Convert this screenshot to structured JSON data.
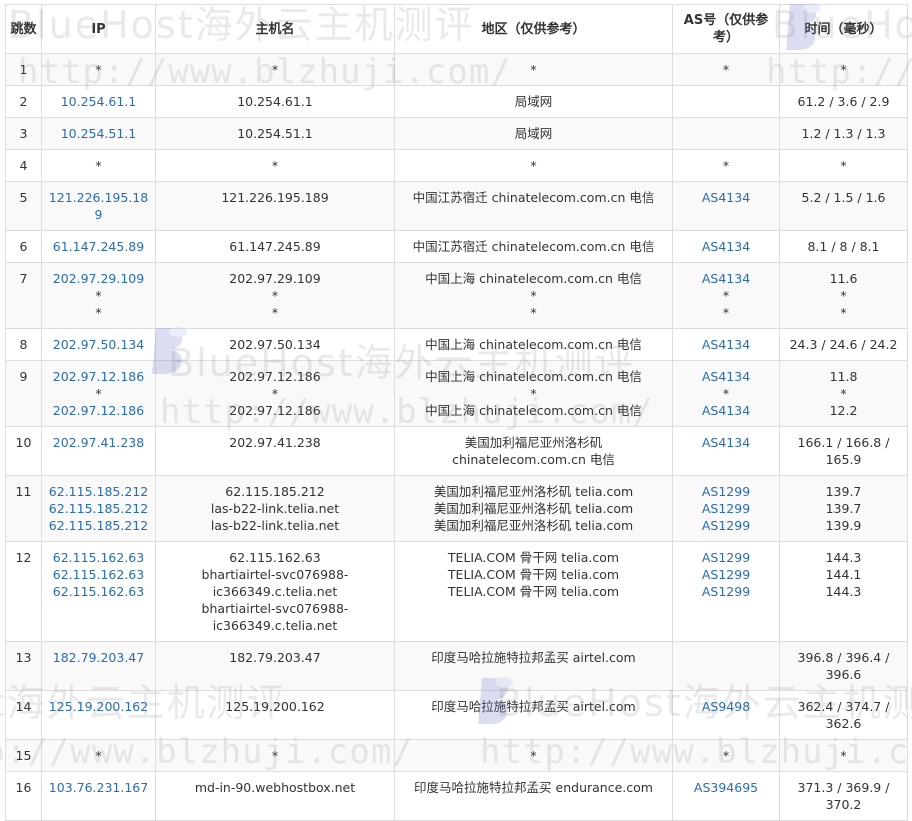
{
  "watermark": {
    "brand": "BlueHost海外云主机测评",
    "url": "http://www.blzhuji.com/"
  },
  "headers": {
    "hop": "跳数",
    "ip": "IP",
    "host": "主机名",
    "region": "地区（仅供参考）",
    "as": "AS号（仅供参考）",
    "time": "时间（毫秒）"
  },
  "colors": {
    "link": "#2b6cb0",
    "border": "#dddddd",
    "stripe": "#f9f9f9"
  },
  "rows": [
    {
      "hop": "1",
      "ip": [
        "*"
      ],
      "host": [
        "*"
      ],
      "region": [
        "*"
      ],
      "as": [
        "*"
      ],
      "time": [
        "*"
      ]
    },
    {
      "hop": "2",
      "ip": [
        "10.254.61.1"
      ],
      "host": [
        "10.254.61.1"
      ],
      "region": [
        "局域网"
      ],
      "as": [
        ""
      ],
      "time": [
        "61.2 / 3.6 / 2.9"
      ]
    },
    {
      "hop": "3",
      "ip": [
        "10.254.51.1"
      ],
      "host": [
        "10.254.51.1"
      ],
      "region": [
        "局域网"
      ],
      "as": [
        ""
      ],
      "time": [
        "1.2 / 1.3 / 1.3"
      ]
    },
    {
      "hop": "4",
      "ip": [
        "*"
      ],
      "host": [
        "*"
      ],
      "region": [
        "*"
      ],
      "as": [
        "*"
      ],
      "time": [
        "*"
      ]
    },
    {
      "hop": "5",
      "ip": [
        "121.226.195.189"
      ],
      "host": [
        "121.226.195.189"
      ],
      "region": [
        "中国江苏宿迁 chinatelecom.com.cn 电信"
      ],
      "as": [
        "AS4134"
      ],
      "time": [
        "5.2 / 1.5 / 1.6"
      ]
    },
    {
      "hop": "6",
      "ip": [
        "61.147.245.89"
      ],
      "host": [
        "61.147.245.89"
      ],
      "region": [
        "中国江苏宿迁 chinatelecom.com.cn 电信"
      ],
      "as": [
        "AS4134"
      ],
      "time": [
        "8.1 / 8 / 8.1"
      ]
    },
    {
      "hop": "7",
      "ip": [
        "202.97.29.109",
        "*",
        "*"
      ],
      "host": [
        "202.97.29.109",
        "*",
        "*"
      ],
      "region": [
        "中国上海 chinatelecom.com.cn 电信",
        "*",
        "*"
      ],
      "as": [
        "AS4134",
        "*",
        "*"
      ],
      "time": [
        "11.6",
        "*",
        "*"
      ]
    },
    {
      "hop": "8",
      "ip": [
        "202.97.50.134"
      ],
      "host": [
        "202.97.50.134"
      ],
      "region": [
        "中国上海 chinatelecom.com.cn 电信"
      ],
      "as": [
        "AS4134"
      ],
      "time": [
        "24.3 / 24.6 / 24.2"
      ]
    },
    {
      "hop": "9",
      "ip": [
        "202.97.12.186",
        "*",
        "202.97.12.186"
      ],
      "host": [
        "202.97.12.186",
        "*",
        "202.97.12.186"
      ],
      "region": [
        "中国上海 chinatelecom.com.cn 电信",
        "*",
        "中国上海 chinatelecom.com.cn 电信"
      ],
      "as": [
        "AS4134",
        "*",
        "AS4134"
      ],
      "time": [
        "11.8",
        "*",
        "12.2"
      ]
    },
    {
      "hop": "10",
      "ip": [
        "202.97.41.238"
      ],
      "host": [
        "202.97.41.238"
      ],
      "region": [
        "美国加利福尼亚州洛杉矶",
        "chinatelecom.com.cn 电信"
      ],
      "as": [
        "AS4134"
      ],
      "time": [
        "166.1 / 166.8 /",
        "165.9"
      ]
    },
    {
      "hop": "11",
      "ip": [
        "62.115.185.212",
        "62.115.185.212",
        "62.115.185.212"
      ],
      "host": [
        "62.115.185.212",
        "las-b22-link.telia.net",
        "las-b22-link.telia.net"
      ],
      "region": [
        "美国加利福尼亚州洛杉矶 telia.com",
        "美国加利福尼亚州洛杉矶 telia.com",
        "美国加利福尼亚州洛杉矶 telia.com"
      ],
      "as": [
        "AS1299",
        "AS1299",
        "AS1299"
      ],
      "time": [
        "139.7",
        "139.7",
        "139.9"
      ]
    },
    {
      "hop": "12",
      "ip": [
        "62.115.162.63",
        "62.115.162.63",
        "62.115.162.63"
      ],
      "host": [
        "62.115.162.63",
        "bhartiairtel-svc076988-",
        "ic366349.c.telia.net",
        "bhartiairtel-svc076988-",
        "ic366349.c.telia.net"
      ],
      "region": [
        "TELIA.COM 骨干网 telia.com",
        "TELIA.COM 骨干网 telia.com",
        "TELIA.COM 骨干网 telia.com"
      ],
      "as": [
        "AS1299",
        "AS1299",
        "AS1299"
      ],
      "time": [
        "144.3",
        "144.1",
        "144.3"
      ]
    },
    {
      "hop": "13",
      "ip": [
        "182.79.203.47"
      ],
      "host": [
        "182.79.203.47"
      ],
      "region": [
        "印度马哈拉施特拉邦孟买 airtel.com"
      ],
      "as": [
        ""
      ],
      "time": [
        "396.8 / 396.4 /",
        "396.6"
      ]
    },
    {
      "hop": "14",
      "ip": [
        "125.19.200.162"
      ],
      "host": [
        "125.19.200.162"
      ],
      "region": [
        "印度马哈拉施特拉邦孟买 airtel.com"
      ],
      "as": [
        "AS9498"
      ],
      "time": [
        "362.4 / 374.7 /",
        "362.6"
      ]
    },
    {
      "hop": "15",
      "ip": [
        "*"
      ],
      "host": [
        "*"
      ],
      "region": [
        "*"
      ],
      "as": [
        "*"
      ],
      "time": [
        "*"
      ]
    },
    {
      "hop": "16",
      "ip": [
        "103.76.231.167"
      ],
      "host": [
        "md-in-90.webhostbox.net"
      ],
      "region": [
        "印度马哈拉施特拉邦孟买 endurance.com"
      ],
      "as": [
        "AS394695"
      ],
      "time": [
        "371.3 / 369.9 /",
        "370.2"
      ]
    }
  ]
}
